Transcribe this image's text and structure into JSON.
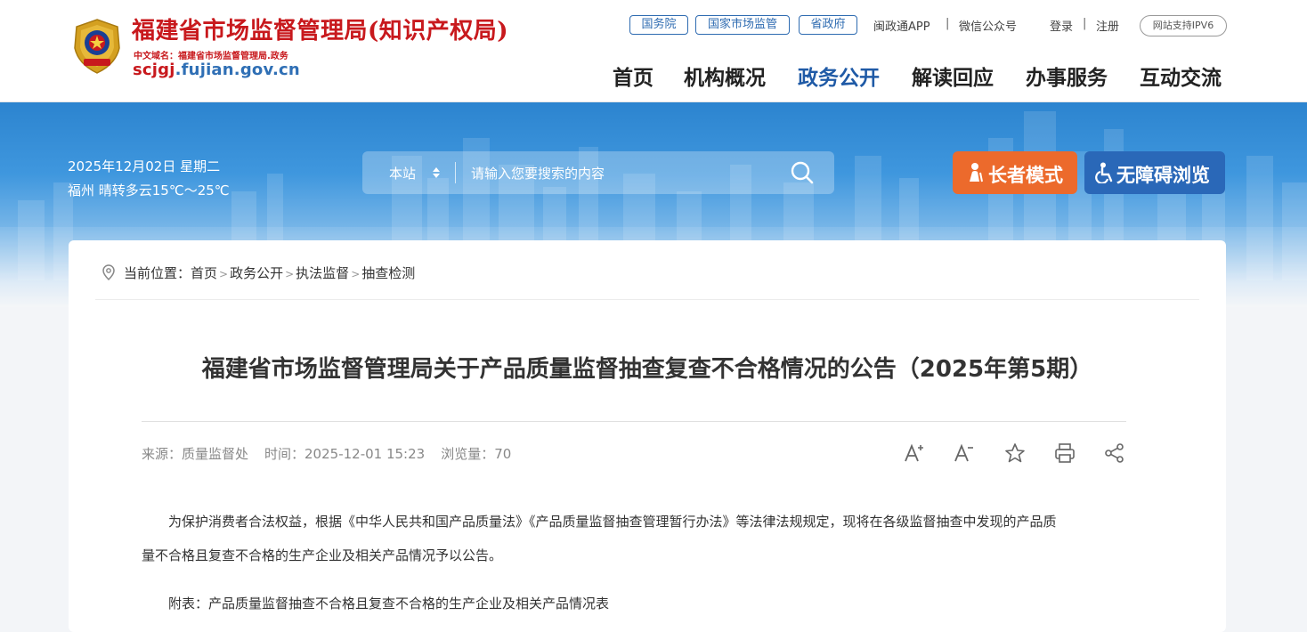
{
  "header": {
    "site_name": "福建省市场监督管理局(知识产权局)",
    "cn_domain": "中文域名：福建省市场监督管理局.政务",
    "domain_prefix": "scjgj",
    "domain_suffix": ".fujian.gov.cn",
    "top_links": [
      "国务院",
      "国家市场监管",
      "省政府"
    ],
    "app_link": "闽政通APP",
    "wechat_link": "微信公众号",
    "login": "登录",
    "register": "注册",
    "ipv6": "网站支持IPV6",
    "nav": [
      "首页",
      "机构概况",
      "政务公开",
      "解读回应",
      "办事服务",
      "互动交流"
    ],
    "active_nav": "政务公开"
  },
  "banner": {
    "date": "2025年12月02日 星期二",
    "weather": "福州 晴转多云15℃～25℃",
    "search_scope": "本站",
    "search_placeholder": "请输入您要搜索的内容",
    "elder_mode": "长者模式",
    "accessible": "无障碍浏览",
    "elder_color": "#ec6a2c",
    "accessible_color": "#2a68b8"
  },
  "breadcrumb": {
    "prefix": "当前位置：",
    "items": [
      "首页",
      "政务公开",
      "执法监督",
      "抽查检测"
    ]
  },
  "article": {
    "title": "福建省市场监督管理局关于产品质量监督抽查复查不合格情况的公告（2025年第5期）",
    "source": "来源：质量监督处",
    "time": "时间：2025-12-01 15:23",
    "views": "浏览量：70",
    "para1_line1": "为保护消费者合法权益，根据《中华人民共和国产品质量法》《产品质量监督抽查管理暂行办法》等法律法规规定，现将在各级监督抽查中发现的产品质",
    "para1_line2": "量不合格且复查不合格的生产企业及相关产品情况予以公告。",
    "para2": "附表：产品质量监督抽查不合格且复查不合格的生产企业及相关产品情况表"
  },
  "colors": {
    "brand_red": "#c8191d",
    "nav_active": "#1f5aa6"
  }
}
